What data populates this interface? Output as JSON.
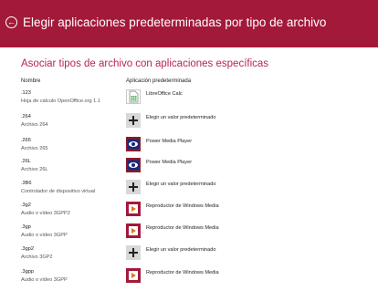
{
  "header": {
    "back_icon": "back-arrow-icon",
    "title": "Elegir aplicaciones predeterminadas por tipo de archivo",
    "color": "#a3193a"
  },
  "section": {
    "subtitle": "Asociar tipos de archivo con aplicaciones específicas"
  },
  "columns": {
    "name": "Nombre",
    "app": "Aplicación predeterminada"
  },
  "rows": [
    {
      "ext": ".123",
      "desc": "Hoja de cálculo OpenOffice.org 1.1",
      "app": "LibreOffice Calc",
      "icon": "libreoffice-calc-icon"
    },
    {
      "ext": ".264",
      "desc": "Archivo 264",
      "app": "Elegir un valor predeterminado",
      "icon": "plus-icon"
    },
    {
      "ext": ".265",
      "desc": "Archivo 265",
      "app": "Power Media Player",
      "icon": "power-media-player-icon"
    },
    {
      "ext": ".26L",
      "desc": "Archivo 26L",
      "app": "Power Media Player",
      "icon": "power-media-player-icon"
    },
    {
      "ext": ".3B6",
      "desc": "Controlador de dispositivo virtual",
      "app": "Elegir un valor predeterminado",
      "icon": "plus-icon"
    },
    {
      "ext": ".3g2",
      "desc": "Audio o vídeo 3GPP2",
      "app": "Reproductor de Windows Media",
      "icon": "windows-media-player-icon"
    },
    {
      "ext": ".3gp",
      "desc": "Audio o vídeo 3GPP",
      "app": "Reproductor de Windows Media",
      "icon": "windows-media-player-icon"
    },
    {
      "ext": ".3gp2",
      "desc": "Archivo 3GP2",
      "app": "Elegir un valor predeterminado",
      "icon": "plus-icon"
    },
    {
      "ext": ".3gpp",
      "desc": "Audio o vídeo 3GPP",
      "app": "Reproductor de Windows Media",
      "icon": "windows-media-player-icon"
    }
  ]
}
